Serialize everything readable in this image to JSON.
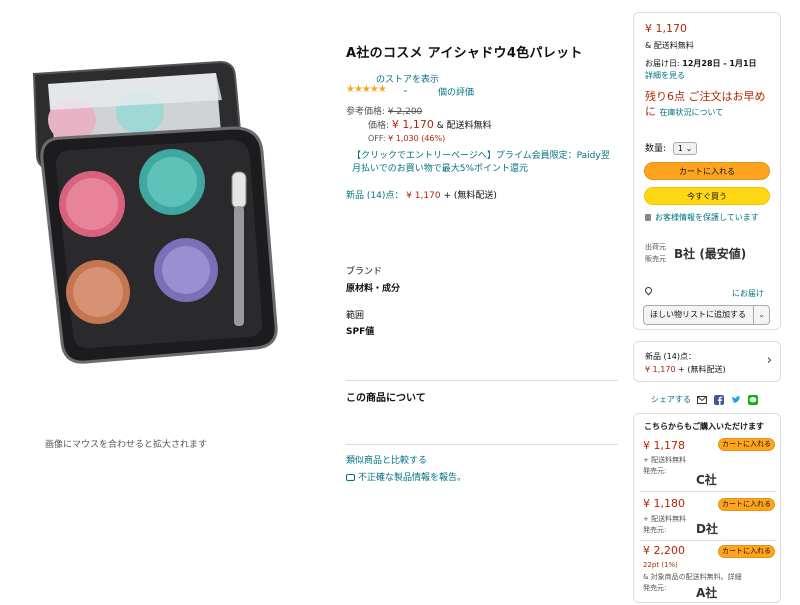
{
  "image_area": {
    "hover_hint": "画像にマウスを合わせると拡大されます"
  },
  "product": {
    "title": "A社のコスメ アイシャドウ4色パレット",
    "store_link": "のストアを表示",
    "rating_stars": "★★★★★",
    "rating_caret": "⌄",
    "ratings_link": "個の評価",
    "ref_price_label": "参考価格:",
    "ref_price": "¥ 2,200",
    "price_label": "価格:",
    "price": "¥ 1,170",
    "price_shipping": "& 配送料無料",
    "off_label": "OFF:",
    "off_value": "¥ 1,030 (46%)",
    "promo": "【クリックでエントリーページへ】プライム会員限定：Paidy翌月払いでのお買い物で最大5%ポイント還元",
    "new_label": "新品 (14)点：",
    "new_price": "¥ 1,170",
    "new_suffix": "+ (無料配送)",
    "specs": {
      "brand": "ブランド",
      "material": "原材料・成分",
      "range": "範囲",
      "spf": "SPF値"
    },
    "about_heading": "この商品について",
    "compare_link": "類似商品と比較する",
    "report_link": "不正確な製品情報を報告。"
  },
  "buybox": {
    "price": "¥ 1,170",
    "shipping": "& 配送料無料",
    "delivery_label": "お届け日:",
    "delivery_dates": "12月28日 - 1月1日",
    "detail_link": "詳細を見る",
    "stock": "残り6点 ご注文はお早めに",
    "stock_link": "在庫状況について",
    "qty_label": "数量:",
    "qty_value": "1",
    "qty_caret": "⌄",
    "add_to_cart": "カートに入れる",
    "buy_now": "今すぐ買う",
    "secure": "お客様情報を保護しています",
    "shipper_label": "出荷元",
    "seller_label": "販売元",
    "seller_name": "B社 (最安値)",
    "deliver_to": "にお届け",
    "wishlist": "ほしい物リストに追加する",
    "wishlist_caret": "⌄"
  },
  "newbox": {
    "line1": "新品 (14)点：",
    "line2_price": "¥ 1,170",
    "line2_suffix": "+ (無料配送)",
    "chevron": "›"
  },
  "share": {
    "label": "シェアする"
  },
  "others": {
    "heading": "こちらからもご購入いただけます",
    "offers": [
      {
        "price": "¥ 1,178",
        "button": "カートに入れる",
        "sub1": "+ 配送料無料",
        "sub2": "発売元:",
        "seller": "C社"
      },
      {
        "price": "¥ 1,180",
        "button": "カートに入れる",
        "sub1": "+ 配送料無料",
        "sub2": "発売元:",
        "seller": "D社"
      },
      {
        "price": "¥ 2,200",
        "button": "カートに入れる",
        "sub1": "22pt  (1%)",
        "sub2": "& 対象商品の配送料無料。詳細",
        "sub3": "発売元:",
        "seller": "A社"
      }
    ]
  },
  "colors": {
    "price_red": "#b12704",
    "link_teal": "#007185",
    "cart_orange": "#ffa41c",
    "buy_yellow": "#ffd814",
    "star": "#ffa41c"
  },
  "icons": [
    "mail-icon",
    "facebook-icon",
    "twitter-icon",
    "line-icon",
    "lock-icon",
    "location-pin-icon",
    "chevron-right-icon",
    "report-icon"
  ]
}
